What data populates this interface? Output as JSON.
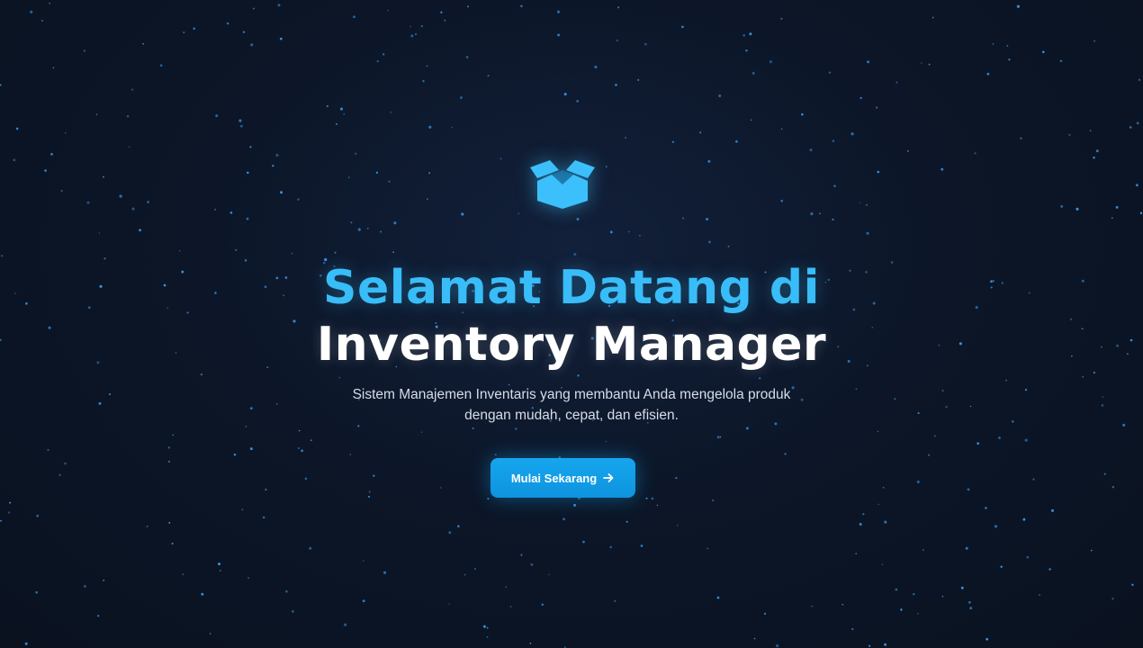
{
  "hero": {
    "logo_icon": "open-box-icon",
    "title_line1": "Selamat Datang di",
    "title_line2": "Inventory Manager",
    "subtitle_line1": "Sistem Manajemen Inventaris yang membantu Anda mengelola produk",
    "subtitle_line2": "dengan mudah, cepat, dan efisien.",
    "cta_label": "Mulai Sekarang",
    "cta_icon": "arrow-right-icon"
  },
  "colors": {
    "background": "#0c1628",
    "accent": "#38bdf8",
    "button": "#0ea5e9",
    "title_secondary": "#ffffff",
    "star": "#3b9cf0"
  }
}
